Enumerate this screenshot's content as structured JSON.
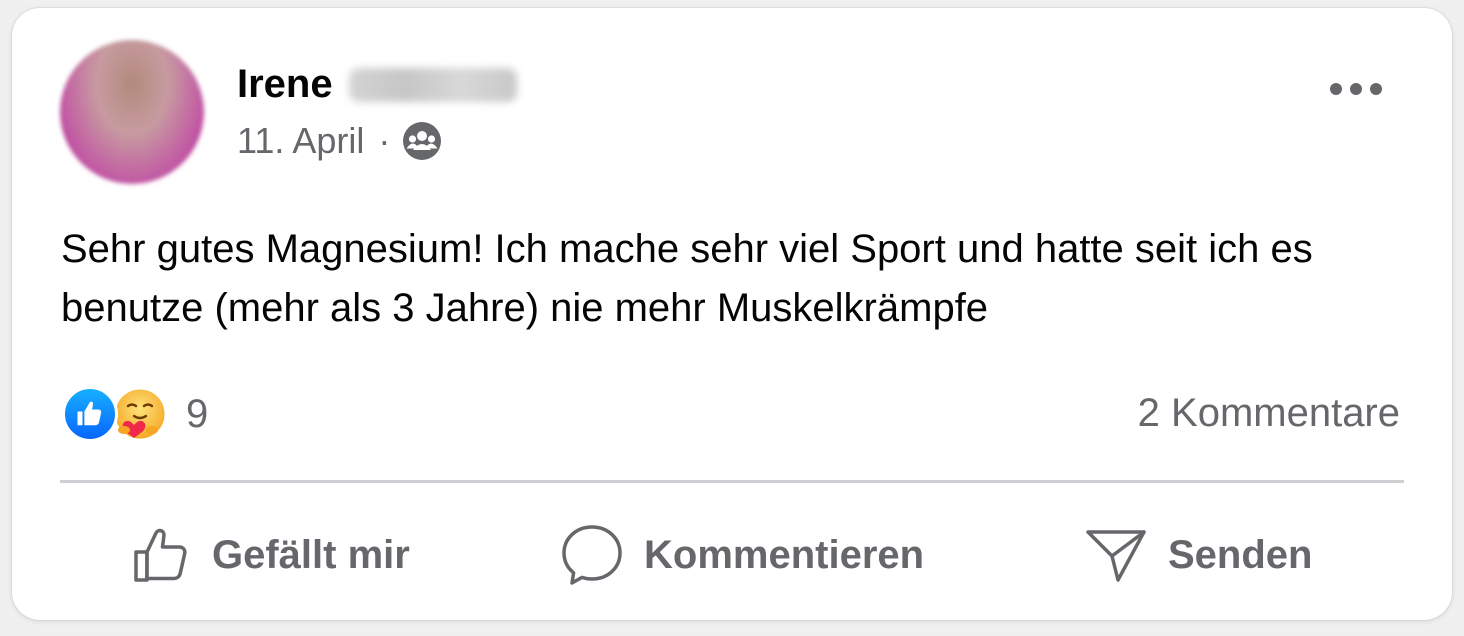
{
  "post": {
    "author_first_name": "Irene",
    "date": "11. April",
    "separator": "·",
    "audience_icon": "friends-group-icon",
    "more_icon": "more-options-icon",
    "text": "Sehr gutes Magnesium! Ich mache sehr viel Sport und hatte seit ich es benutze (mehr als 3 Jahre) nie mehr Muskelkrämpfe"
  },
  "reactions": {
    "icons": [
      "like-reaction-icon",
      "care-reaction-icon"
    ],
    "count": "9",
    "comments_label": "2 Kommentare"
  },
  "actions": {
    "like_label": "Gefällt mir",
    "comment_label": "Kommentieren",
    "send_label": "Senden"
  },
  "colors": {
    "text_primary": "#050505",
    "text_secondary": "#65676b",
    "like_blue": "#0866ff",
    "divider": "#ced0d4"
  }
}
